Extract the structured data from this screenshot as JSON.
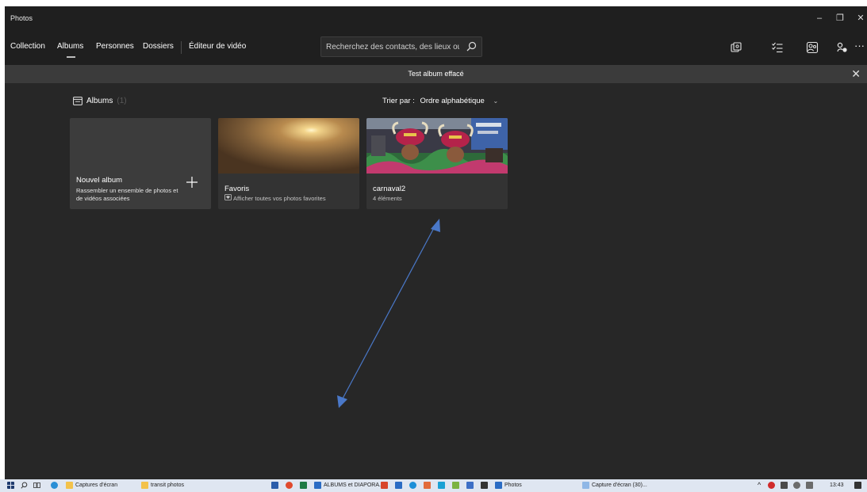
{
  "app": {
    "title": "Photos"
  },
  "window_controls": {
    "minimize": "–",
    "restore": "❐",
    "close": "✕"
  },
  "nav": {
    "tabs": [
      "Collection",
      "Albums",
      "Personnes",
      "Dossiers",
      "Éditeur de vidéo"
    ],
    "active": "Albums",
    "more": "···"
  },
  "search": {
    "placeholder": "Recherchez des contacts, des lieux ou"
  },
  "toolbar_icons": [
    "import-icon",
    "select-icon",
    "people-icon",
    "share-icon"
  ],
  "notification": {
    "text": "Test album effacé",
    "close": "✕"
  },
  "albums_section": {
    "title": "Albums",
    "count": "(1)",
    "sort_label": "Trier par :",
    "sort_value": "Ordre alphabétique",
    "sort_chevron": "⌄"
  },
  "cards": {
    "new_album": {
      "title": "Nouvel album",
      "line1": "Rassembler un ensemble de photos et",
      "line2": "de vidéos associées"
    },
    "favorites": {
      "title": "Favoris",
      "subtitle": "Afficher toutes vos photos favorites"
    },
    "carnaval": {
      "title": "carnaval2",
      "subtitle": "4 éléments"
    }
  },
  "colors": {
    "app_bg": "#272727",
    "bar_bg": "#1f1f1f",
    "notification_bg": "#3b3b3b",
    "annotation_arrow": "#4a78c8",
    "taskbar_bg": "#dfe6f1"
  },
  "taskbar": {
    "items": [
      "Captures d'écran",
      "transit photos",
      "ALBUMS et DIAPORA...",
      "Photos",
      "Capture d'écran (30)..."
    ],
    "time": "13:43"
  }
}
